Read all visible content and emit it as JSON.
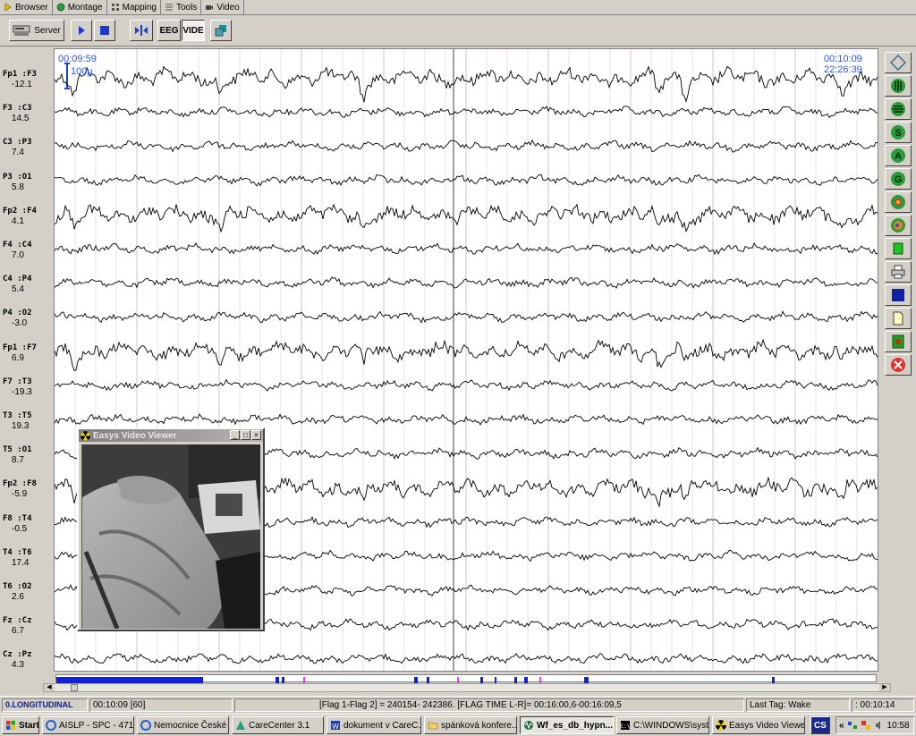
{
  "menu_tabs": [
    {
      "label": "Browser",
      "icon": "browser-arrow-icon"
    },
    {
      "label": "Montage",
      "icon": "montage-icon"
    },
    {
      "label": "Mapping",
      "icon": "mapping-icon"
    },
    {
      "label": "Tools",
      "icon": "tools-icon"
    },
    {
      "label": "Video",
      "icon": "video-icon"
    }
  ],
  "toolbar": {
    "server_label": "Server",
    "eeg_label": "EEG",
    "video_label": "VIDE"
  },
  "eeg": {
    "start_time": "00:09:59",
    "end_time": "00:10:09",
    "clock_time": "22:26:39",
    "scale_label": "100µ",
    "channels": [
      {
        "name": "Fp1 :F3",
        "value": "-12.1"
      },
      {
        "name": "F3  :C3",
        "value": "14.5"
      },
      {
        "name": "C3  :P3",
        "value": "7.4"
      },
      {
        "name": "P3  :O1",
        "value": "5.8"
      },
      {
        "name": "Fp2 :F4",
        "value": "4.1"
      },
      {
        "name": "F4  :C4",
        "value": "7.0"
      },
      {
        "name": "C4  :P4",
        "value": "5.4"
      },
      {
        "name": "P4  :O2",
        "value": "-3.0"
      },
      {
        "name": "Fp1 :F7",
        "value": "6.9"
      },
      {
        "name": "F7  :T3",
        "value": "-19.3"
      },
      {
        "name": "T3  :T5",
        "value": "19.3"
      },
      {
        "name": "T5  :O1",
        "value": "8.7"
      },
      {
        "name": "Fp2 :F8",
        "value": "-5.9"
      },
      {
        "name": "F8  :T4",
        "value": "-0.5"
      },
      {
        "name": "T4  :T6",
        "value": "17.4"
      },
      {
        "name": "T6  :O2",
        "value": "2.6"
      },
      {
        "name": "Fz  :Cz",
        "value": "6.7"
      },
      {
        "name": "Cz  :Pz",
        "value": "4.3"
      }
    ]
  },
  "video_viewer": {
    "title": "Easys Video Viewer"
  },
  "status": {
    "montage": "0.LONGITUDINAL",
    "position": "00:10:09 [60]",
    "flags": "[Flag 1-Flag 2] =  240154-  242386.  [FLAG TIME L-R]= 00:16:00,6-00:16:09,5",
    "last_tag": "Last Tag:  Wake",
    "elapsed": ": 00:10:14"
  },
  "taskbar": {
    "start_label": "Start",
    "tasks": [
      {
        "label": "AISLP - SPC - 471...",
        "icon": "ie-icon"
      },
      {
        "label": "Nemocnice České ...",
        "icon": "ie-icon"
      },
      {
        "label": "CareCenter 3.1",
        "icon": "carecenter-icon"
      },
      {
        "label": "dokument v CareC...",
        "icon": "word-icon"
      },
      {
        "label": "spánková konfere...",
        "icon": "folder-icon"
      },
      {
        "label": "Wf_es_db_hypn...",
        "icon": "wave-icon"
      },
      {
        "label": "C:\\WINDOWS\\syst...",
        "icon": "console-icon"
      },
      {
        "label": "Easys Video Viewer",
        "icon": "radiation-icon"
      }
    ],
    "lang": "CS",
    "clock": "10:58"
  }
}
